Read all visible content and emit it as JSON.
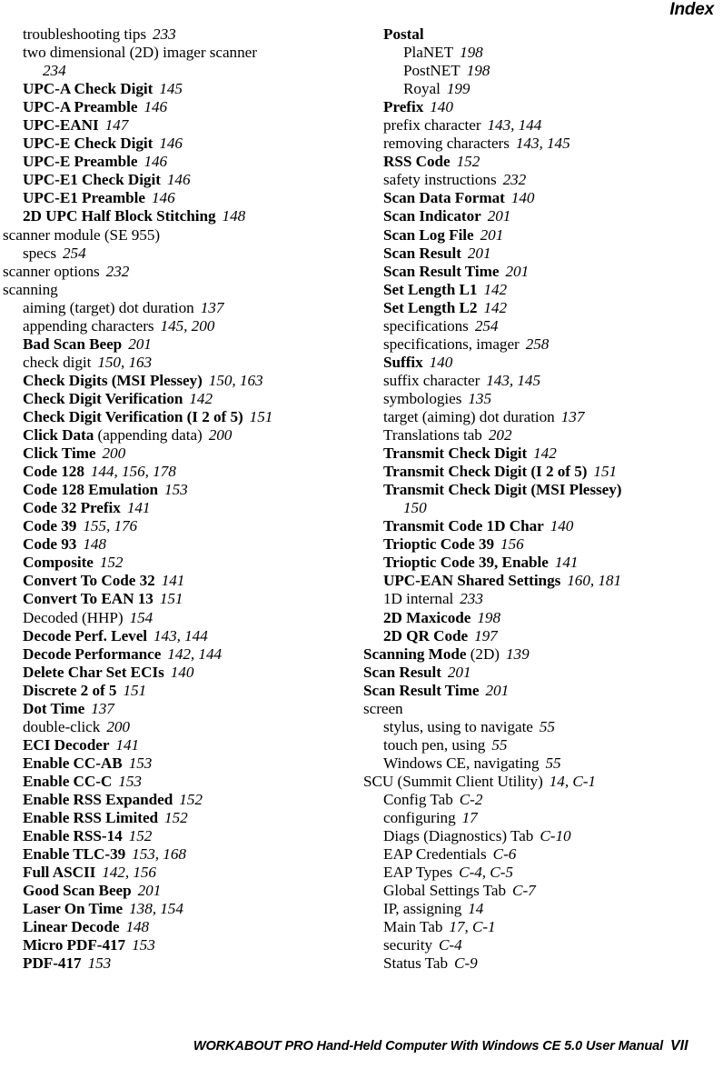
{
  "header": {
    "running_head": "Index"
  },
  "footer": {
    "manual_title": "WORKABOUT PRO Hand-Held Computer With Windows CE 5.0 User Manual",
    "page_number": "VII"
  },
  "columns": {
    "left": [
      {
        "level": 1,
        "bold": false,
        "term": "troubleshooting tips",
        "qual": "",
        "pages": "233"
      },
      {
        "level": 1,
        "bold": false,
        "term": "two dimensional (2D) imager scanner",
        "qual": "",
        "pages": "",
        "wrap": "234"
      },
      {
        "level": 1,
        "bold": true,
        "term": "UPC-A Check Digit",
        "qual": "",
        "pages": "145"
      },
      {
        "level": 1,
        "bold": true,
        "term": "UPC-A Preamble",
        "qual": "",
        "pages": "146"
      },
      {
        "level": 1,
        "bold": true,
        "term": "UPC-EANI",
        "qual": "",
        "pages": "147"
      },
      {
        "level": 1,
        "bold": true,
        "term": "UPC-E Check Digit",
        "qual": "",
        "pages": "146"
      },
      {
        "level": 1,
        "bold": true,
        "term": "UPC-E Preamble",
        "qual": "",
        "pages": "146"
      },
      {
        "level": 1,
        "bold": true,
        "term": "UPC-E1 Check Digit",
        "qual": "",
        "pages": "146"
      },
      {
        "level": 1,
        "bold": true,
        "term": "UPC-E1 Preamble",
        "qual": "",
        "pages": "146"
      },
      {
        "level": 1,
        "bold": true,
        "term": "2D UPC Half Block Stitching",
        "qual": "",
        "pages": "148"
      },
      {
        "level": 0,
        "bold": false,
        "term": "scanner module (SE 955)",
        "qual": "",
        "pages": ""
      },
      {
        "level": 1,
        "bold": false,
        "term": "specs",
        "qual": "",
        "pages": "254"
      },
      {
        "level": 0,
        "bold": false,
        "term": "scanner options",
        "qual": "",
        "pages": "232"
      },
      {
        "level": 0,
        "bold": false,
        "term": "scanning",
        "qual": "",
        "pages": ""
      },
      {
        "level": 1,
        "bold": false,
        "term": "aiming (target) dot duration",
        "qual": "",
        "pages": "137"
      },
      {
        "level": 1,
        "bold": false,
        "term": "appending characters",
        "qual": "",
        "pages": "145, 200"
      },
      {
        "level": 1,
        "bold": true,
        "term": "Bad Scan Beep",
        "qual": "",
        "pages": "201"
      },
      {
        "level": 1,
        "bold": false,
        "term": "check digit",
        "qual": "",
        "pages": "150, 163"
      },
      {
        "level": 1,
        "bold": true,
        "term": "Check Digits (MSI Plessey)",
        "qual": "",
        "pages": "150, 163"
      },
      {
        "level": 1,
        "bold": true,
        "term": "Check Digit Verification",
        "qual": "",
        "pages": "142"
      },
      {
        "level": 1,
        "bold": true,
        "term": "Check Digit Verification (I 2 of 5)",
        "qual": "",
        "pages": "151"
      },
      {
        "level": 1,
        "bold": true,
        "term": "Click Data",
        "qual": " (appending data)",
        "pages": "200"
      },
      {
        "level": 1,
        "bold": true,
        "term": "Click Time",
        "qual": "",
        "pages": "200"
      },
      {
        "level": 1,
        "bold": true,
        "term": "Code 128",
        "qual": "",
        "pages": "144, 156, 178"
      },
      {
        "level": 1,
        "bold": true,
        "term": "Code 128 Emulation",
        "qual": "",
        "pages": "153"
      },
      {
        "level": 1,
        "bold": true,
        "term": "Code 32 Prefix",
        "qual": "",
        "pages": "141"
      },
      {
        "level": 1,
        "bold": true,
        "term": "Code 39",
        "qual": "",
        "pages": "155, 176"
      },
      {
        "level": 1,
        "bold": true,
        "term": "Code 93",
        "qual": "",
        "pages": "148"
      },
      {
        "level": 1,
        "bold": true,
        "term": "Composite",
        "qual": "",
        "pages": "152"
      },
      {
        "level": 1,
        "bold": true,
        "term": "Convert To Code 32",
        "qual": "",
        "pages": "141"
      },
      {
        "level": 1,
        "bold": true,
        "term": "Convert To EAN 13",
        "qual": "",
        "pages": "151"
      },
      {
        "level": 1,
        "bold": false,
        "term": "Decoded (HHP)",
        "qual": "",
        "pages": "154"
      },
      {
        "level": 1,
        "bold": true,
        "term": "Decode Perf. Level",
        "qual": "",
        "pages": "143, 144"
      },
      {
        "level": 1,
        "bold": true,
        "term": "Decode Performance",
        "qual": "",
        "pages": "142, 144"
      },
      {
        "level": 1,
        "bold": true,
        "term": "Delete Char Set ECIs",
        "qual": "",
        "pages": "140"
      },
      {
        "level": 1,
        "bold": true,
        "term": "Discrete 2 of 5",
        "qual": "",
        "pages": "151"
      },
      {
        "level": 1,
        "bold": true,
        "term": "Dot Time",
        "qual": "",
        "pages": "137"
      },
      {
        "level": 1,
        "bold": false,
        "term": "double-click",
        "qual": "",
        "pages": "200"
      },
      {
        "level": 1,
        "bold": true,
        "term": "ECI Decoder",
        "qual": "",
        "pages": "141"
      },
      {
        "level": 1,
        "bold": true,
        "term": "Enable CC-AB",
        "qual": "",
        "pages": "153"
      },
      {
        "level": 1,
        "bold": true,
        "term": "Enable CC-C",
        "qual": "",
        "pages": "153"
      },
      {
        "level": 1,
        "bold": true,
        "term": "Enable RSS Expanded",
        "qual": "",
        "pages": "152"
      },
      {
        "level": 1,
        "bold": true,
        "term": "Enable RSS Limited",
        "qual": "",
        "pages": "152"
      },
      {
        "level": 1,
        "bold": true,
        "term": "Enable RSS-14",
        "qual": "",
        "pages": "152"
      },
      {
        "level": 1,
        "bold": true,
        "term": "Enable TLC-39",
        "qual": "",
        "pages": "153, 168"
      },
      {
        "level": 1,
        "bold": true,
        "term": "Full ASCII",
        "qual": "",
        "pages": "142, 156"
      },
      {
        "level": 1,
        "bold": true,
        "term": "Good Scan Beep",
        "qual": "",
        "pages": "201"
      },
      {
        "level": 1,
        "bold": true,
        "term": "Laser On Time",
        "qual": "",
        "pages": "138, 154"
      },
      {
        "level": 1,
        "bold": true,
        "term": "Linear Decode",
        "qual": "",
        "pages": "148"
      },
      {
        "level": 1,
        "bold": true,
        "term": "Micro PDF-417",
        "qual": "",
        "pages": "153"
      },
      {
        "level": 1,
        "bold": true,
        "term": "PDF-417",
        "qual": "",
        "pages": "153"
      }
    ],
    "right": [
      {
        "level": 1,
        "bold": true,
        "term": "Postal",
        "qual": "",
        "pages": ""
      },
      {
        "level": 2,
        "bold": false,
        "term": "PlaNET",
        "qual": "",
        "pages": "198"
      },
      {
        "level": 2,
        "bold": false,
        "term": "PostNET",
        "qual": "",
        "pages": "198"
      },
      {
        "level": 2,
        "bold": false,
        "term": "Royal",
        "qual": "",
        "pages": "199"
      },
      {
        "level": 1,
        "bold": true,
        "term": "Prefix",
        "qual": "",
        "pages": "140"
      },
      {
        "level": 1,
        "bold": false,
        "term": "prefix character",
        "qual": "",
        "pages": "143, 144"
      },
      {
        "level": 1,
        "bold": false,
        "term": "removing characters",
        "qual": "",
        "pages": "143, 145"
      },
      {
        "level": 1,
        "bold": true,
        "term": "RSS Code",
        "qual": "",
        "pages": "152"
      },
      {
        "level": 1,
        "bold": false,
        "term": "safety instructions",
        "qual": "",
        "pages": "232"
      },
      {
        "level": 1,
        "bold": true,
        "term": "Scan Data Format",
        "qual": "",
        "pages": "140"
      },
      {
        "level": 1,
        "bold": true,
        "term": "Scan Indicator",
        "qual": "",
        "pages": "201"
      },
      {
        "level": 1,
        "bold": true,
        "term": "Scan Log File",
        "qual": "",
        "pages": "201"
      },
      {
        "level": 1,
        "bold": true,
        "term": "Scan Result",
        "qual": "",
        "pages": "201"
      },
      {
        "level": 1,
        "bold": true,
        "term": "Scan Result Time",
        "qual": "",
        "pages": "201"
      },
      {
        "level": 1,
        "bold": true,
        "term": "Set Length L1",
        "qual": "",
        "pages": "142"
      },
      {
        "level": 1,
        "bold": true,
        "term": "Set Length L2",
        "qual": "",
        "pages": "142"
      },
      {
        "level": 1,
        "bold": false,
        "term": "specifications",
        "qual": "",
        "pages": "254"
      },
      {
        "level": 1,
        "bold": false,
        "term": "specifications, imager",
        "qual": "",
        "pages": "258"
      },
      {
        "level": 1,
        "bold": true,
        "term": "Suffix",
        "qual": "",
        "pages": "140"
      },
      {
        "level": 1,
        "bold": false,
        "term": "suffix character",
        "qual": "",
        "pages": "143, 145"
      },
      {
        "level": 1,
        "bold": false,
        "term": "symbologies",
        "qual": "",
        "pages": "135"
      },
      {
        "level": 1,
        "bold": false,
        "term": "target (aiming) dot duration",
        "qual": "",
        "pages": "137"
      },
      {
        "level": 1,
        "bold": false,
        "term": "Translations tab",
        "qual": "",
        "pages": "202"
      },
      {
        "level": 1,
        "bold": true,
        "term": "Transmit Check Digit",
        "qual": "",
        "pages": "142"
      },
      {
        "level": 1,
        "bold": true,
        "term": "Transmit Check Digit (I 2 of 5)",
        "qual": "",
        "pages": "151"
      },
      {
        "level": 1,
        "bold": true,
        "term": "Transmit Check Digit (MSI Plessey)",
        "qual": "",
        "pages": "",
        "wrap": "150"
      },
      {
        "level": 1,
        "bold": true,
        "term": "Transmit Code 1D Char",
        "qual": "",
        "pages": "140"
      },
      {
        "level": 1,
        "bold": true,
        "term": "Trioptic Code 39",
        "qual": "",
        "pages": "156"
      },
      {
        "level": 1,
        "bold": true,
        "term": "Trioptic Code 39, Enable",
        "qual": "",
        "pages": "141"
      },
      {
        "level": 1,
        "bold": true,
        "term": "UPC-EAN Shared Settings",
        "qual": "",
        "pages": "160, 181"
      },
      {
        "level": 1,
        "bold": false,
        "term": "1D internal",
        "qual": "",
        "pages": "233"
      },
      {
        "level": 1,
        "bold": true,
        "term": "2D Maxicode",
        "qual": "",
        "pages": "198"
      },
      {
        "level": 1,
        "bold": true,
        "term": "2D QR Code",
        "qual": "",
        "pages": "197"
      },
      {
        "level": 0,
        "bold": true,
        "term": "Scanning Mode",
        "qual": " (2D)",
        "pages": "139"
      },
      {
        "level": 0,
        "bold": true,
        "term": "Scan Result",
        "qual": "",
        "pages": "201"
      },
      {
        "level": 0,
        "bold": true,
        "term": "Scan Result Time",
        "qual": "",
        "pages": "201"
      },
      {
        "level": 0,
        "bold": false,
        "term": "screen",
        "qual": "",
        "pages": ""
      },
      {
        "level": 1,
        "bold": false,
        "term": "stylus, using to navigate",
        "qual": "",
        "pages": "55"
      },
      {
        "level": 1,
        "bold": false,
        "term": "touch pen, using",
        "qual": "",
        "pages": "55"
      },
      {
        "level": 1,
        "bold": false,
        "term": "Windows CE, navigating",
        "qual": "",
        "pages": "55"
      },
      {
        "level": 0,
        "bold": false,
        "term": "SCU (Summit Client Utility)",
        "qual": "",
        "pages": "14, C-1"
      },
      {
        "level": 1,
        "bold": false,
        "term": "Config Tab",
        "qual": "",
        "pages": "C-2"
      },
      {
        "level": 1,
        "bold": false,
        "term": "configuring",
        "qual": "",
        "pages": "17"
      },
      {
        "level": 1,
        "bold": false,
        "term": "Diags (Diagnostics) Tab",
        "qual": "",
        "pages": "C-10"
      },
      {
        "level": 1,
        "bold": false,
        "term": "EAP Credentials",
        "qual": "",
        "pages": "C-6"
      },
      {
        "level": 1,
        "bold": false,
        "term": "EAP Types",
        "qual": "",
        "pages": "C-4, C-5"
      },
      {
        "level": 1,
        "bold": false,
        "term": "Global Settings Tab",
        "qual": "",
        "pages": "C-7"
      },
      {
        "level": 1,
        "bold": false,
        "term": "IP, assigning",
        "qual": "",
        "pages": "14"
      },
      {
        "level": 1,
        "bold": false,
        "term": "Main Tab",
        "qual": "",
        "pages": "17, C-1"
      },
      {
        "level": 1,
        "bold": false,
        "term": "security",
        "qual": "",
        "pages": "C-4"
      },
      {
        "level": 1,
        "bold": false,
        "term": "Status Tab",
        "qual": "",
        "pages": "C-9"
      }
    ]
  }
}
